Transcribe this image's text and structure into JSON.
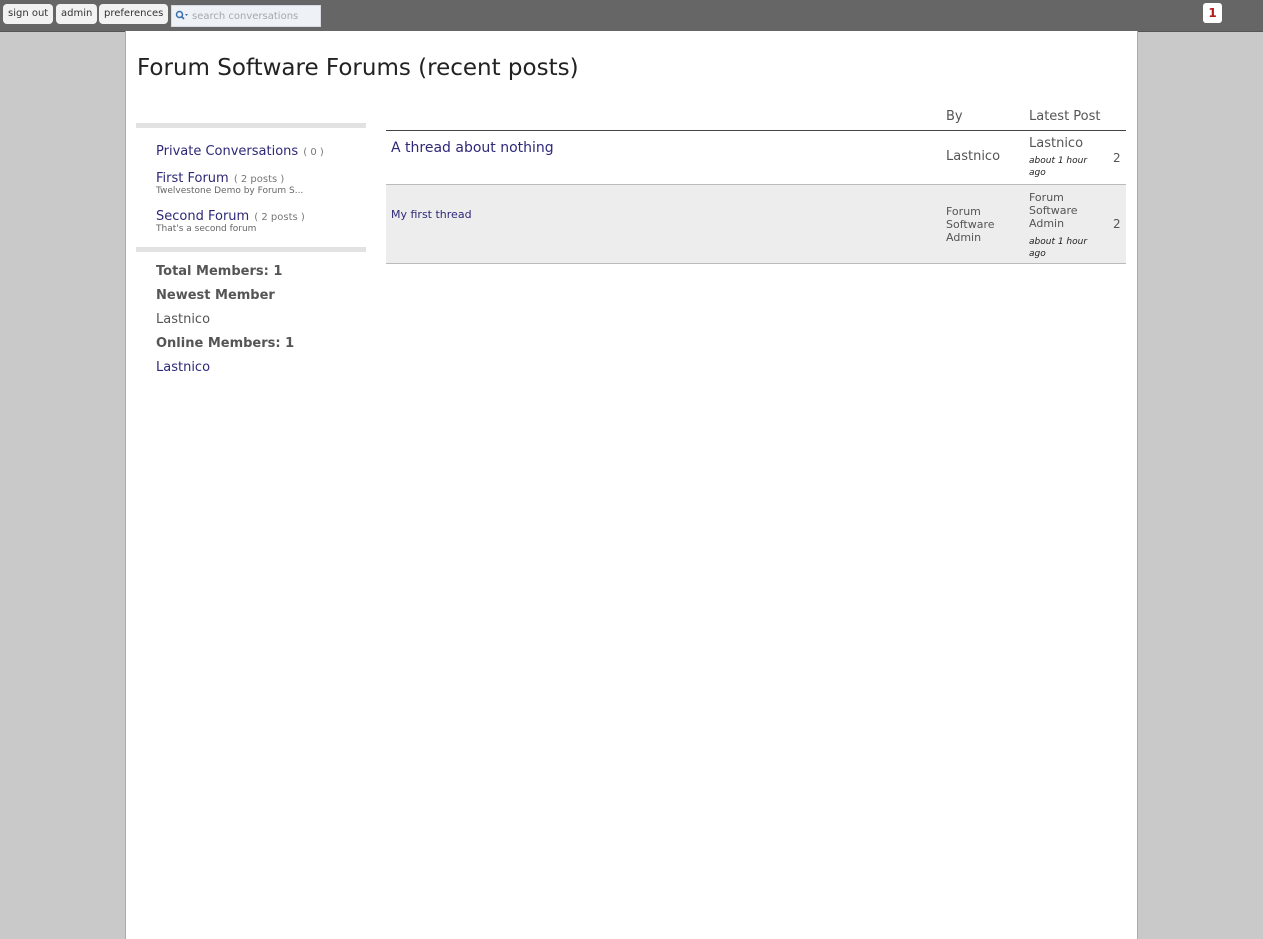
{
  "topbar": {
    "sign_out": "sign out",
    "admin": "admin",
    "preferences": "preferences",
    "search_placeholder": "search conversations",
    "notification_count": "1"
  },
  "page": {
    "title": "Forum Software Forums (recent posts)"
  },
  "sidebar": {
    "forums": [
      {
        "name": "Private Conversations",
        "count": "( 0 )",
        "desc": ""
      },
      {
        "name": "First Forum",
        "count": "( 2 posts )",
        "desc": "Twelvestone Demo by Forum S..."
      },
      {
        "name": "Second Forum",
        "count": "( 2 posts )",
        "desc": "That's a second forum"
      }
    ],
    "stats": {
      "total_members": "Total Members: 1",
      "newest_label": "Newest Member",
      "newest_value": "Lastnico",
      "online_label": "Online Members: 1",
      "online_value": "Lastnico"
    }
  },
  "threads": {
    "headers": {
      "by": "By",
      "latest": "Latest Post"
    },
    "rows": [
      {
        "title": "A thread about nothing",
        "by": "Lastnico",
        "latest_name": "Lastnico",
        "latest_time": "about 1 hour ago",
        "count": "2"
      },
      {
        "title": "My first thread",
        "by": "Forum Software Admin",
        "latest_name": "Forum Software Admin",
        "latest_time": "about 1 hour ago",
        "count": "2"
      }
    ]
  },
  "colors": {
    "topbar": "#666666",
    "link": "#2e2878",
    "notif": "#b01c1c"
  }
}
